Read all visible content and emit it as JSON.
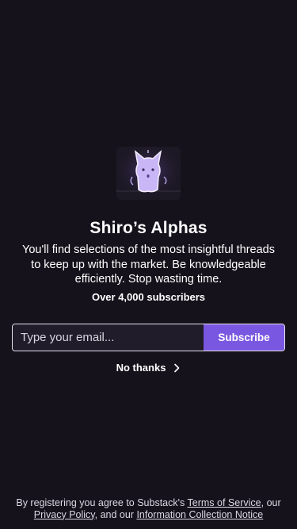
{
  "publication": {
    "title": "Shiro’s Alphas",
    "description": "You'll find selections of the most insightful threads to keep up with the market. Be knowledgeable efficiently. Stop wasting time.",
    "subscriber_count": "Over 4,000 subscribers",
    "logo_icon": "cat-ghost-logo-icon"
  },
  "signup": {
    "email_placeholder": "Type your email...",
    "email_value": "",
    "subscribe_label": "Subscribe"
  },
  "dismiss": {
    "label": "No thanks",
    "icon": "chevron-right-icon"
  },
  "legal": {
    "prefix": "By registering you agree to Substack's ",
    "terms_label": "Terms of Service",
    "middle1": ", our ",
    "privacy_label": "Privacy Policy",
    "middle2": ", and our ",
    "notice_label": "Information Collection Notice"
  },
  "colors": {
    "background": "#15121b",
    "accent": "#7a57e0",
    "input_background": "#201c29"
  }
}
